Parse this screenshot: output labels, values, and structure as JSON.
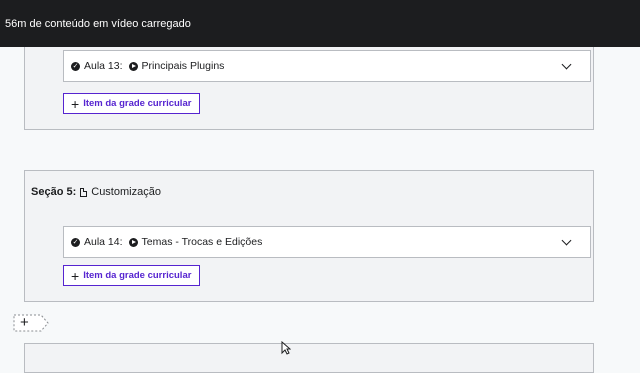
{
  "topbar": {
    "message": "56m de conteúdo em vídeo carregado"
  },
  "section_a": {
    "lecture": {
      "prefix": "Aula 13:",
      "title": "Principais Plugins"
    },
    "add_item_label": "Item da grade curricular"
  },
  "section_b": {
    "label": "Seção 5:",
    "title": "Customização",
    "lecture": {
      "prefix": "Aula 14:",
      "title": "Temas - Trocas e Edições"
    },
    "add_item_label": "Item da grade curricular"
  },
  "add_section_label": "+",
  "icons": {
    "completed": "check-circle-icon",
    "video": "play-circle-icon",
    "expand": "chevron-down-icon",
    "document": "document-icon",
    "add": "plus-icon"
  },
  "colors": {
    "topbar_bg": "#1c1d1f",
    "accent": "#5624d0",
    "section_bg": "#f2f3f5",
    "border": "#b9bcc1"
  }
}
